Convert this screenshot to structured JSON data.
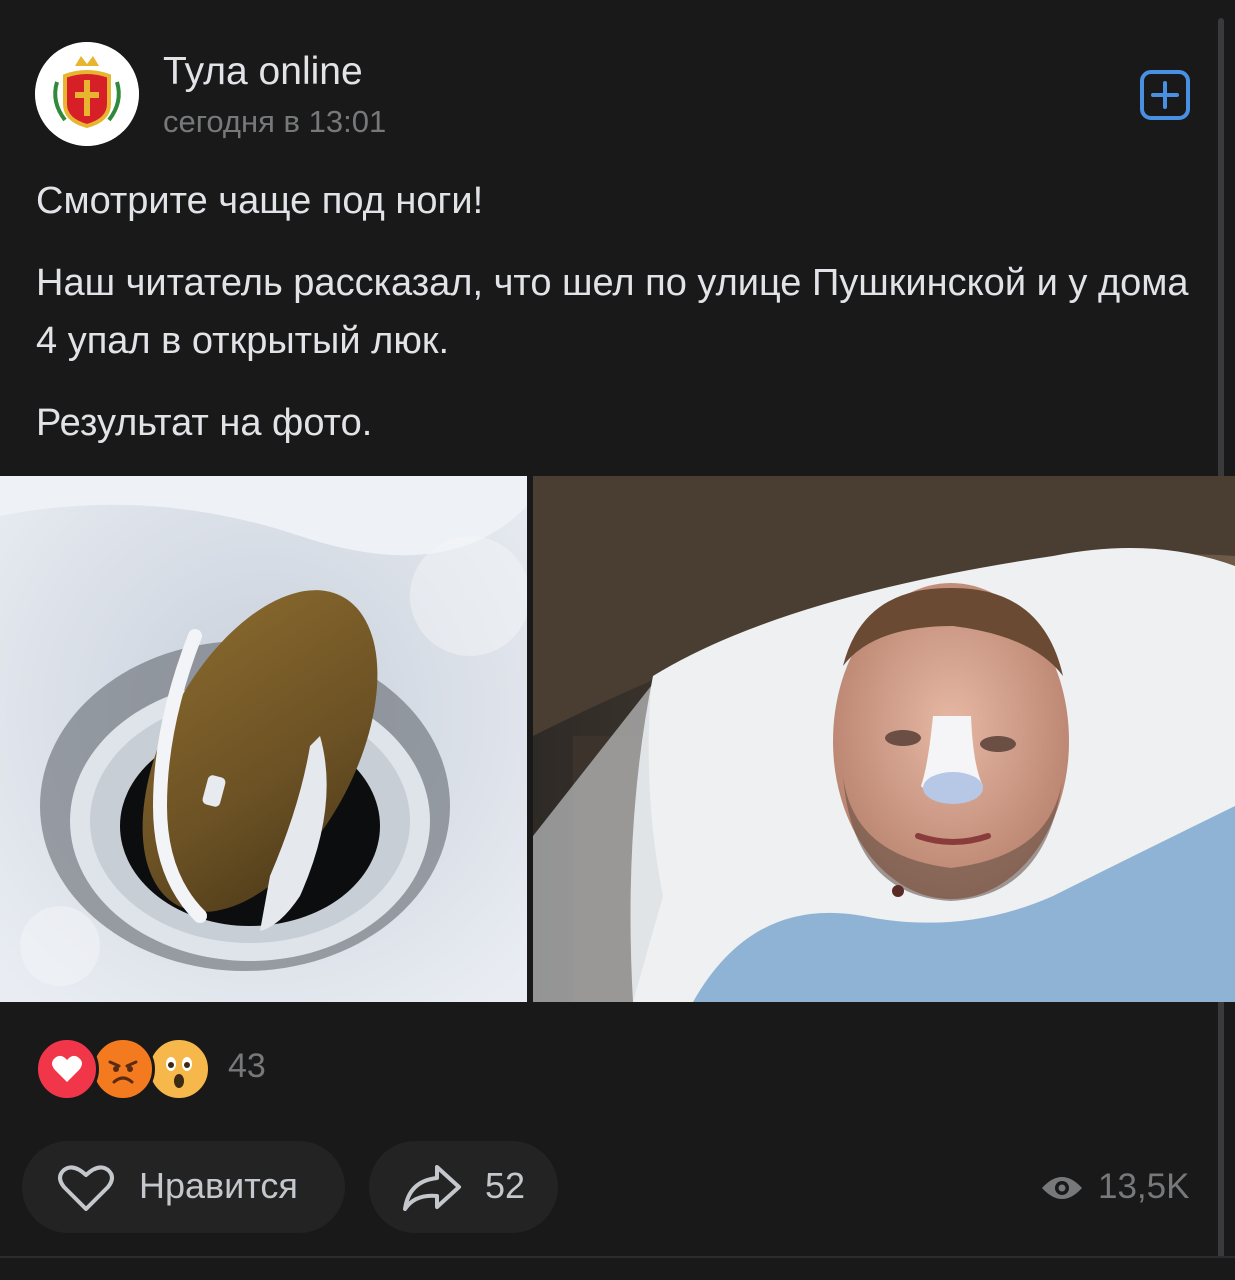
{
  "post": {
    "author": "Тула online",
    "time": "сегодня в 13:01",
    "paragraphs": [
      "Смотрите чаще под ноги!",
      "Наш читатель рассказал, что шел по улице Пушкинской и у дома 4 упал в открытый люк.",
      "Результат на фото."
    ]
  },
  "reactions": {
    "icons": [
      "heart-reaction",
      "angry-reaction",
      "surprised-reaction"
    ],
    "count": "43"
  },
  "actions": {
    "like_label": "Нравится",
    "share_count": "52",
    "views": "13,5K"
  },
  "colors": {
    "background": "#19191a",
    "text": "#e1e3e6",
    "secondary": "#76787a",
    "accent": "#4a90e2",
    "heart": "#f2364a"
  }
}
